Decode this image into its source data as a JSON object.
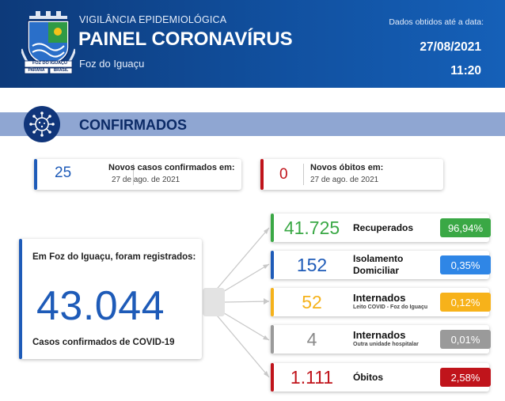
{
  "header": {
    "subtitle": "VIGILÂNCIA EPIDEMIOLÓGICA",
    "title": "PAINEL CORONAVÍRUS",
    "city": "Foz do Iguaçu",
    "data_label": "Dados obtidos até a data:",
    "date": "27/08/2021",
    "time": "11:20",
    "crest_text_1": "FOZ DO IGUAÇU",
    "crest_text_2": "PARANÁ",
    "crest_text_3": "BRASIL"
  },
  "section": {
    "title": "CONFIRMADOS"
  },
  "new_cases": {
    "value": "25",
    "title": "Novos casos confirmados em:",
    "date": "27 de ago. de 2021"
  },
  "new_deaths": {
    "value": "0",
    "title": "Novos óbitos em:",
    "date": "27 de ago. de 2021"
  },
  "total": {
    "label": "Em Foz do Iguaçu, foram registrados:",
    "value": "43.044",
    "caption": "Casos confirmados de COVID-19"
  },
  "stats": [
    {
      "value": "41.725",
      "label": "Recuperados",
      "label2": "",
      "sub": "",
      "pct": "96,94%",
      "accent": "#3aa845",
      "pct_color": "#3aa845",
      "num_color": "#3aa845"
    },
    {
      "value": "152",
      "label": "Isolamento",
      "label2": "Domiciliar",
      "sub": "",
      "pct": "0,35%",
      "accent": "#1e5bb8",
      "pct_color": "#2f86e6",
      "num_color": "#1e5bb8"
    },
    {
      "value": "52",
      "label": "Internados",
      "label2": "",
      "sub": "Leito COVID - Foz do Iguaçu",
      "pct": "0,12%",
      "accent": "#f5b21b",
      "pct_color": "#f7b21a",
      "num_color": "#f5b21b"
    },
    {
      "value": "4",
      "label": "Internados",
      "label2": "",
      "sub": "Outra unidade hospitalar",
      "pct": "0,01%",
      "accent": "#9a9a9a",
      "pct_color": "#9a9a9a",
      "num_color": "#8a8a8a"
    },
    {
      "value": "1.111",
      "label": "Óbitos",
      "label2": "",
      "sub": "",
      "pct": "2,58%",
      "accent": "#c0141b",
      "pct_color": "#c0141b",
      "num_color": "#c0141b"
    }
  ],
  "colors": {
    "header_dark": "#0d3a7a",
    "header_light": "#1560b8",
    "section_bar": "#8fa6d2",
    "section_text": "#0b2a66",
    "primary_blue": "#1e5bb8",
    "danger_red": "#c0141b"
  }
}
